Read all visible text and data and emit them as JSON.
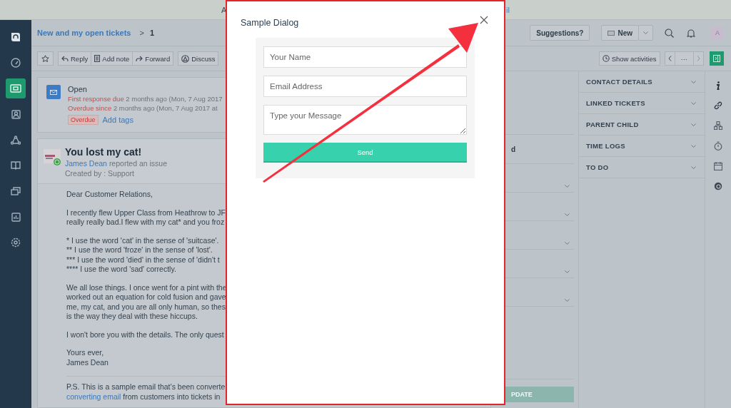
{
  "top_banner": {
    "left_text": "A",
    "right_text": "il"
  },
  "nav_items": [
    {
      "kind": "logo",
      "selected": false
    },
    {
      "kind": "dashboard",
      "selected": false
    },
    {
      "kind": "tickets",
      "selected": true
    },
    {
      "kind": "contacts",
      "selected": false
    },
    {
      "kind": "groups",
      "selected": false
    },
    {
      "kind": "solutions",
      "selected": false
    },
    {
      "kind": "forums",
      "selected": false
    },
    {
      "kind": "reports",
      "selected": false
    },
    {
      "kind": "settings",
      "selected": false
    }
  ],
  "breadcrumb": {
    "link": "New and my open tickets",
    "separator": ">",
    "current": "1"
  },
  "header_actions": {
    "suggestions": "Suggestions?",
    "new_button": "New",
    "avatar": "A"
  },
  "toolbar": {
    "buttons": [
      {
        "kind": "reply",
        "label": "Reply"
      },
      {
        "kind": "note",
        "label": "Add note"
      },
      {
        "kind": "forward",
        "label": "Forward"
      },
      {
        "kind": "discuss",
        "label": "Discuss"
      }
    ],
    "show_activities": "Show activities",
    "pager_more": "···"
  },
  "status_card": {
    "status": "Open",
    "lines": [
      {
        "label": "First response due",
        "text": "2 months ago (Mon, 7 Aug 2017"
      },
      {
        "label": "Overdue since",
        "text": "2 months ago (Mon, 7 Aug 2017 at"
      }
    ],
    "badge": "Overdue",
    "add_tags": "Add tags"
  },
  "ticket": {
    "subject": "You lost my cat!",
    "requester": "James Dean",
    "action": "reported an issue",
    "created_by": "Created by : Support",
    "paragraphs": [
      [
        "Dear Customer Relations,"
      ],
      [
        "I recently flew Upper Class from Heathrow to JF",
        "really really bad.I flew with my cat* and you froz"
      ],
      [
        "* I use the word 'cat' in the sense of 'suitcase'.",
        "** I use the word 'froze' in the sense of 'lost'.",
        "*** I use the word 'died' in the sense of 'didn't t",
        "**** I use the word 'sad' correctly."
      ],
      [
        "We all lose things. I once went for a pint with the",
        "worked out an equation for cold fusion and gave",
        "me, my cat, and you are all only human, so thes",
        "is the way they deal with these hiccups."
      ],
      [
        "I won't bore you with the details. The only quest"
      ],
      [
        "Yours ever,",
        "James Dean"
      ]
    ],
    "ps": "P.S. This is a sample email that’s been converte",
    "ps_link": "converting email",
    "ps_rest": " from customers into tickets in"
  },
  "properties": {
    "fields": [
      {
        "kind": "text",
        "label": "d"
      },
      {
        "kind": "select"
      },
      {
        "kind": "select"
      },
      {
        "kind": "select"
      },
      {
        "kind": "select"
      },
      {
        "kind": "select"
      }
    ],
    "update_button": "PDATE"
  },
  "sidebar_sections": [
    {
      "title": "CONTACT DETAILS",
      "expanded": false
    },
    {
      "title": "LINKED TICKETS",
      "expanded": false
    },
    {
      "title": "PARENT CHILD",
      "expanded": false
    },
    {
      "title": "TIME LOGS",
      "expanded": false
    },
    {
      "title": "TO DO",
      "expanded": false
    }
  ],
  "rail_icons": [
    {
      "kind": "info"
    },
    {
      "kind": "link"
    },
    {
      "kind": "hierarchy"
    },
    {
      "kind": "timer"
    },
    {
      "kind": "calendar"
    },
    {
      "kind": "app"
    }
  ],
  "dialog": {
    "title": "Sample Dialog",
    "fields": [
      {
        "kind": "input",
        "placeholder": "Your Name"
      },
      {
        "kind": "input",
        "placeholder": "Email Address"
      },
      {
        "kind": "textarea",
        "placeholder": "Type your Message"
      }
    ],
    "submit": "Send"
  }
}
